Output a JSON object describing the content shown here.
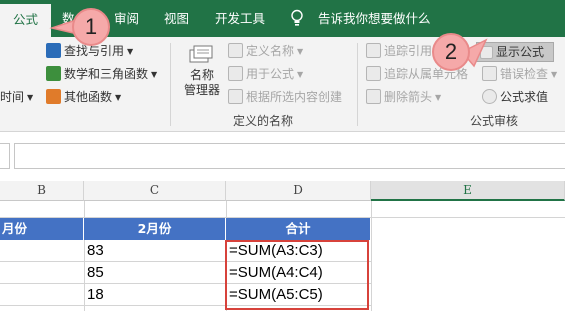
{
  "tabs": {
    "formula": "公式",
    "data_partial": "数",
    "review": "审阅",
    "view": "视图",
    "developer": "开发工具",
    "tell_me": "告诉我你想要做什么"
  },
  "ribbon": {
    "lookup": "查找与引用",
    "math": "数学和三角函数",
    "datetime_partial": "时间",
    "more_functions": "其他函数",
    "name_manager_line1": "名称",
    "name_manager_line2": "管理器",
    "define_name": "定义名称",
    "use_in_formula": "用于公式",
    "create_from_selection": "根据所选内容创建",
    "defined_names_group": "定义的名称",
    "trace_precedents": "追踪引用",
    "trace_dependents": "追踪从属单元格",
    "remove_arrows": "删除箭头",
    "show_formulas": "显示公式",
    "error_checking": "错误检查",
    "evaluate_formula": "公式求值",
    "formula_auditing_group": "公式审核"
  },
  "columns": [
    "B",
    "C",
    "D",
    "E"
  ],
  "table": {
    "headers": [
      "月份",
      "2月份",
      "合计"
    ],
    "rows": [
      {
        "c": "83",
        "d": "=SUM(A3:C3)"
      },
      {
        "c": "85",
        "d": "=SUM(A4:C4)"
      },
      {
        "c": "18",
        "d": "=SUM(A5:C5)"
      }
    ]
  },
  "callouts": [
    "1",
    "2"
  ],
  "colors": {
    "tab_bar": "#217346",
    "header_fill": "#4472c4",
    "highlight_border": "#d7423b",
    "callout_fill": "#f5a9a9"
  }
}
